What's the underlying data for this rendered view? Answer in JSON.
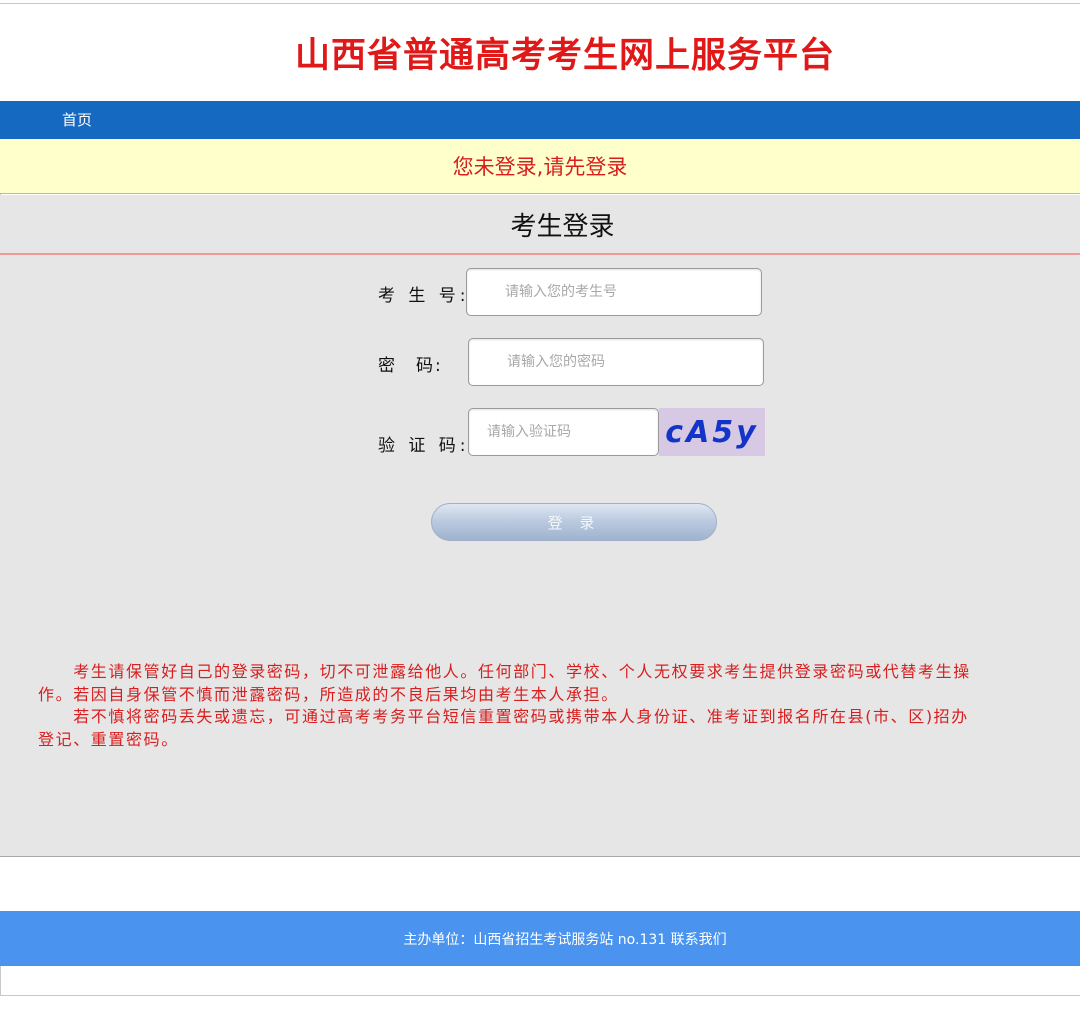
{
  "header": {
    "title": "山西省普通高考考生网上服务平台"
  },
  "nav": {
    "items": [
      {
        "label": "首页"
      }
    ]
  },
  "notice": {
    "text": "您未登录,请先登录"
  },
  "login": {
    "heading": "考生登录",
    "candidate_label": "考 生 号:",
    "candidate_placeholder": "请输入您的考生号",
    "password_label": "密　码:",
    "password_placeholder": "请输入您的密码",
    "captcha_label": "验 证 码:",
    "captcha_placeholder": "请输入验证码",
    "captcha_text": "cA5y",
    "submit_label": "登 录"
  },
  "warning": {
    "lines": [
      "　　考生请保管好自己的登录密码，切不可泄露给他人。任何部门、学校、个人无权要求考生提供登录密码或代替考生操",
      "作。若因自身保管不慎而泄露密码，所造成的不良后果均由考生本人承担。",
      "　　若不慎将密码丢失或遗忘，可通过高考考务平台短信重置密码或携带本人身份证、准考证到报名所在县(市、区)招办",
      "登记、重置密码。"
    ]
  },
  "footer": {
    "text": "主办单位：山西省招生考试服务站   no.131 联系我们"
  },
  "colors": {
    "title_red": "#e01818",
    "nav_blue": "#1569c1",
    "notice_bg": "#ffffcc",
    "footer_blue": "#4a94f0",
    "captcha_bg": "#d7c8e4",
    "captcha_text": "#1234c8"
  }
}
